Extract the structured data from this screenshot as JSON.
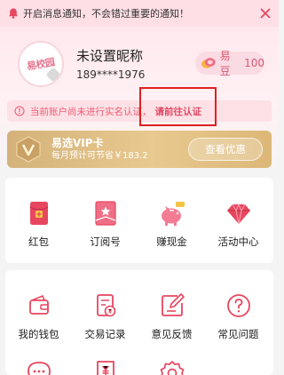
{
  "notification": {
    "text": "开启消息通知，不会错过重要的通知！"
  },
  "profile": {
    "avatar_text": "易校园",
    "nickname": "未设置昵称",
    "phone": "189****1976"
  },
  "coins": {
    "label": "易豆",
    "value": "100"
  },
  "verify": {
    "message": "当前账户尚未进行实名认证，",
    "link": "请前往认证"
  },
  "vip": {
    "title": "易选VIP卡",
    "subtitle": "每月预计可节省￥183.2",
    "button": "查看优惠"
  },
  "grid1": [
    {
      "label": "红包",
      "icon": "red-packet-icon"
    },
    {
      "label": "订阅号",
      "icon": "subscription-icon"
    },
    {
      "label": "赚现金",
      "icon": "piggy-bank-icon"
    },
    {
      "label": "活动中心",
      "icon": "diamond-icon"
    }
  ],
  "grid2": [
    {
      "label": "我的钱包",
      "icon": "wallet-icon"
    },
    {
      "label": "交易记录",
      "icon": "transaction-record-icon"
    },
    {
      "label": "意见反馈",
      "icon": "feedback-icon"
    },
    {
      "label": "常见问题",
      "icon": "faq-icon"
    }
  ],
  "grid3_icons": [
    "chat-icon",
    "receipt-icon",
    "settings-icon"
  ],
  "colors": {
    "accent": "#ef5b74",
    "vip_gold": "#d4b27a",
    "highlight": "#e02020"
  }
}
